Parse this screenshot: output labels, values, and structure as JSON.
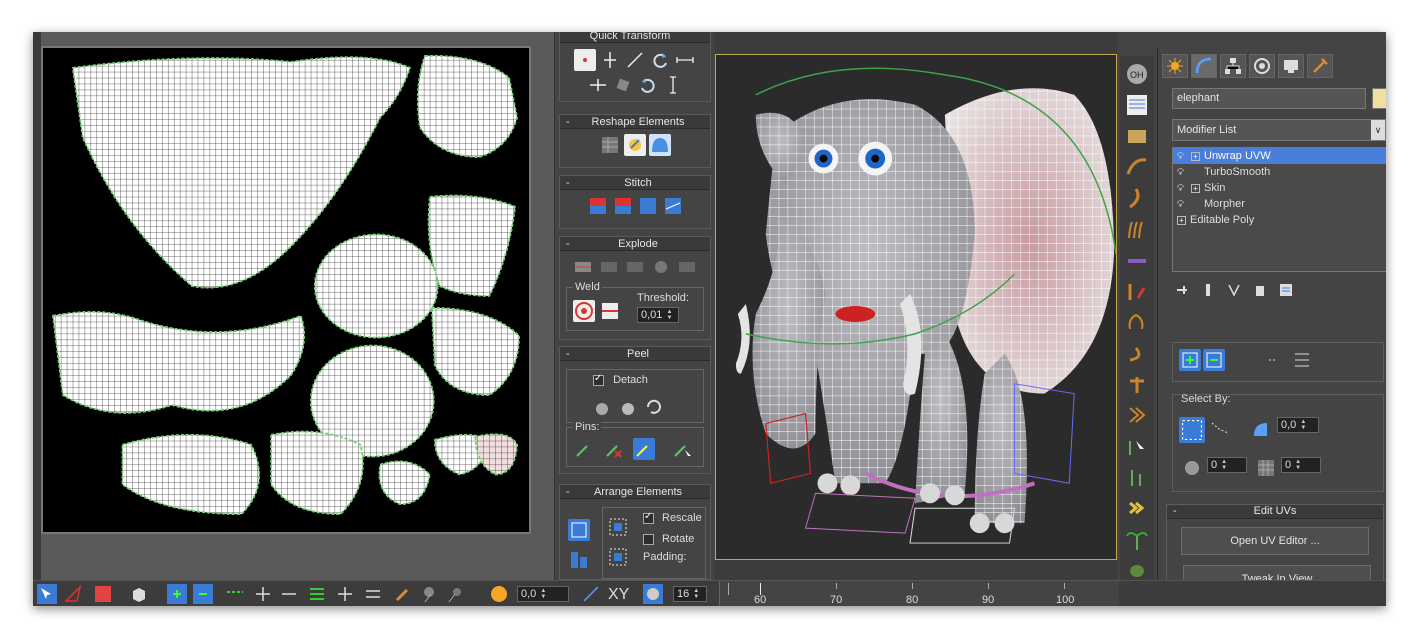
{
  "tool_panel": {
    "quick_transform_title": "Quick Transform",
    "reshape_title": "Reshape Elements",
    "stitch_title": "Stitch",
    "explode_title": "Explode",
    "weld_label": "Weld",
    "threshold_label": "Threshold:",
    "threshold_value": "0,01",
    "peel_title": "Peel",
    "detach_label": "Detach",
    "pins_label": "Pins:",
    "arrange_title": "Arrange Elements",
    "rescale_label": "Rescale",
    "rotate_label": "Rotate",
    "padding_label": "Padding:"
  },
  "command_panel": {
    "object_name": "elephant",
    "object_color": "#f0e0a0",
    "modifier_list_label": "Modifier List",
    "stack": [
      {
        "label": "Unwrap UVW",
        "selected": true,
        "expandable": true
      },
      {
        "label": "TurboSmooth",
        "selected": false,
        "expandable": false
      },
      {
        "label": "Skin",
        "selected": false,
        "expandable": true
      },
      {
        "label": "Morpher",
        "selected": false,
        "expandable": false
      },
      {
        "label": "Editable Poly",
        "selected": false,
        "expandable": true
      }
    ],
    "select_by_label": "Select By:",
    "select_angle_value": "0,0",
    "select_a_value": "0",
    "select_b_value": "0",
    "edit_uvs_title": "Edit UVs",
    "open_uv_editor_label": "Open UV Editor ...",
    "tweak_in_view_label": "Tweak In View"
  },
  "bottom_bar": {
    "spinner_value": "0,0",
    "xy_label": "XY",
    "frame_spinner": "16",
    "timeline_ticks": [
      "60",
      "70",
      "80",
      "90",
      "100"
    ]
  },
  "colors": {
    "selection_blue": "#4a7ed8",
    "viewport_border": "#c8a54a",
    "uv_seam_green": "#6fd06f"
  }
}
